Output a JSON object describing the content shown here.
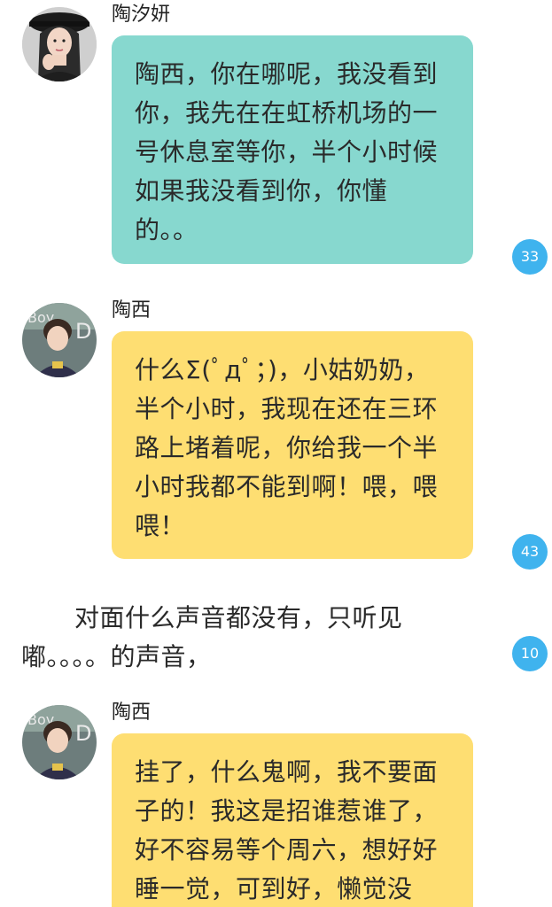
{
  "messages": [
    {
      "sender": "陶汐妍",
      "text": "陶西，你在哪呢，我没看到你，我先在在虹桥机场的一号休息室等你，半个小时候如果我没看到你，你懂的。。",
      "likes": "33"
    },
    {
      "sender": "陶西",
      "text": "什么Σ(ﾟдﾟ；)，小姑奶奶，半个小时，我现在还在三环路上堵着呢，你给我一个半小时我都不能到啊！喂，喂喂！",
      "likes": "43"
    },
    {
      "sender": "陶西",
      "text": "挂了，什么鬼啊，我不要面子的！我这是招谁惹谁了，好不容易等个周六，想好好睡一觉，可到好，懒觉没"
    }
  ],
  "narration": {
    "text": "对面什么声音都没有，只听见嘟。。。。的声音，",
    "likes": "10"
  },
  "colors": {
    "teal_bubble": "#87d8cf",
    "yellow_bubble": "#fede72",
    "badge": "#3fb3ee"
  }
}
